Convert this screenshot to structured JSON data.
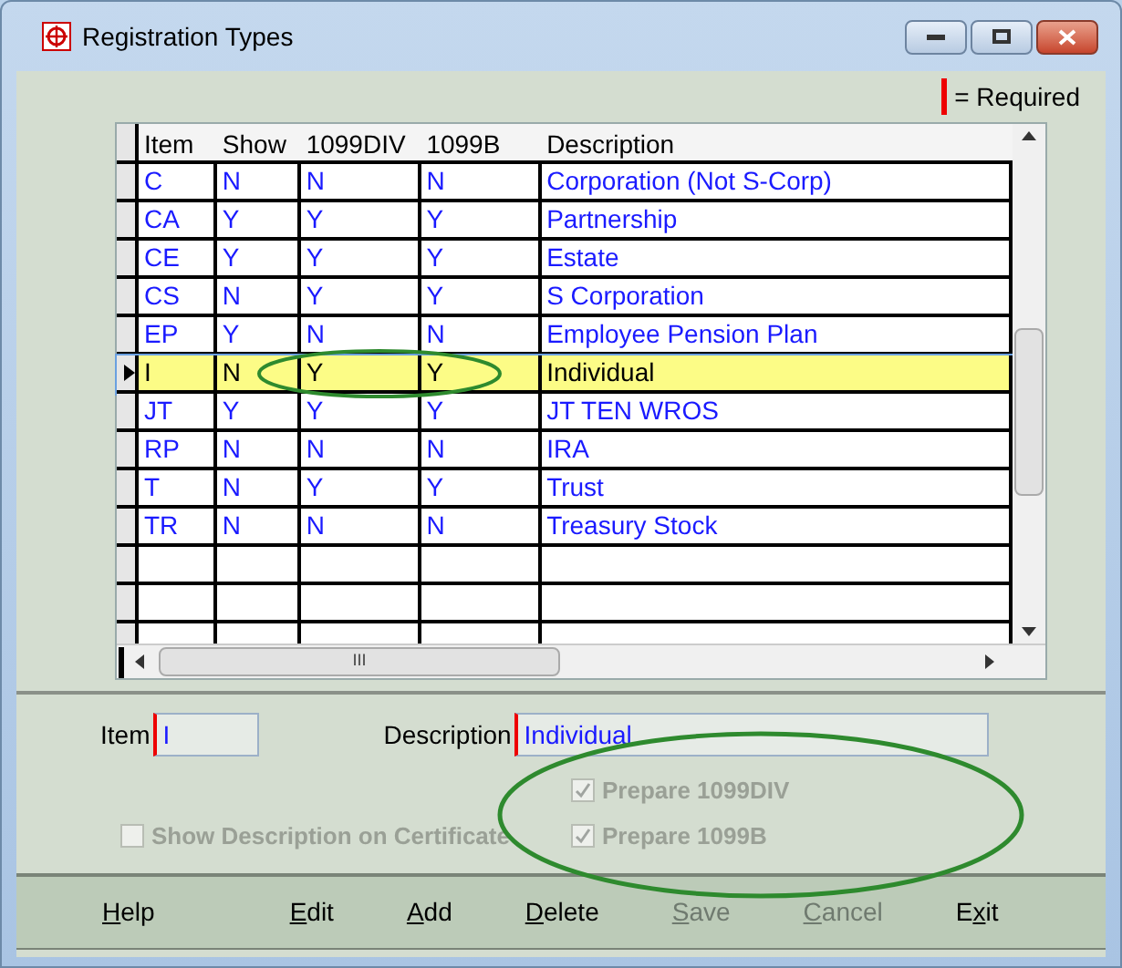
{
  "window": {
    "title": "Registration Types"
  },
  "legend": {
    "text": "= Required"
  },
  "table": {
    "columns": [
      "Item",
      "Show",
      "1099DIV",
      "1099B",
      "Description"
    ],
    "rows": [
      {
        "cells": [
          "C",
          "N",
          "N",
          "N",
          "Corporation (Not S-Corp)"
        ],
        "selected": false
      },
      {
        "cells": [
          "CA",
          "Y",
          "Y",
          "Y",
          "Partnership"
        ],
        "selected": false
      },
      {
        "cells": [
          "CE",
          "Y",
          "Y",
          "Y",
          "Estate"
        ],
        "selected": false
      },
      {
        "cells": [
          "CS",
          "N",
          "Y",
          "Y",
          "S Corporation"
        ],
        "selected": false
      },
      {
        "cells": [
          "EP",
          "Y",
          "N",
          "N",
          "Employee Pension Plan"
        ],
        "selected": false
      },
      {
        "cells": [
          "I",
          "N",
          "Y",
          "Y",
          "Individual"
        ],
        "selected": true
      },
      {
        "cells": [
          "JT",
          "Y",
          "Y",
          "Y",
          "JT TEN WROS"
        ],
        "selected": false
      },
      {
        "cells": [
          "RP",
          "N",
          "N",
          "N",
          "IRA"
        ],
        "selected": false
      },
      {
        "cells": [
          "T",
          "N",
          "Y",
          "Y",
          "Trust"
        ],
        "selected": false
      },
      {
        "cells": [
          "TR",
          "N",
          "N",
          "N",
          "Treasury Stock"
        ],
        "selected": false
      }
    ],
    "scroll_glyph": "III"
  },
  "form": {
    "item": {
      "label": "Item",
      "value": "I"
    },
    "description": {
      "label": "Description",
      "value": "Individual"
    },
    "checkboxes": [
      {
        "label": "Prepare 1099DIV",
        "checked": true,
        "disabled": true
      },
      {
        "label": "Show Description on Certificate",
        "checked": false,
        "disabled": true
      },
      {
        "label": "Prepare 1099B",
        "checked": true,
        "disabled": true
      }
    ]
  },
  "buttons": [
    {
      "key": "H",
      "rest": "elp",
      "disabled": false
    },
    {
      "key": "E",
      "rest": "dit",
      "disabled": false
    },
    {
      "key": "A",
      "rest": "dd",
      "disabled": false
    },
    {
      "key": "D",
      "rest": "elete",
      "disabled": false
    },
    {
      "key": "S",
      "rest": "ave",
      "disabled": true
    },
    {
      "key": "C",
      "rest": "ancel",
      "disabled": true
    },
    {
      "before": "E",
      "key": "x",
      "rest": "it",
      "disabled": false
    }
  ]
}
